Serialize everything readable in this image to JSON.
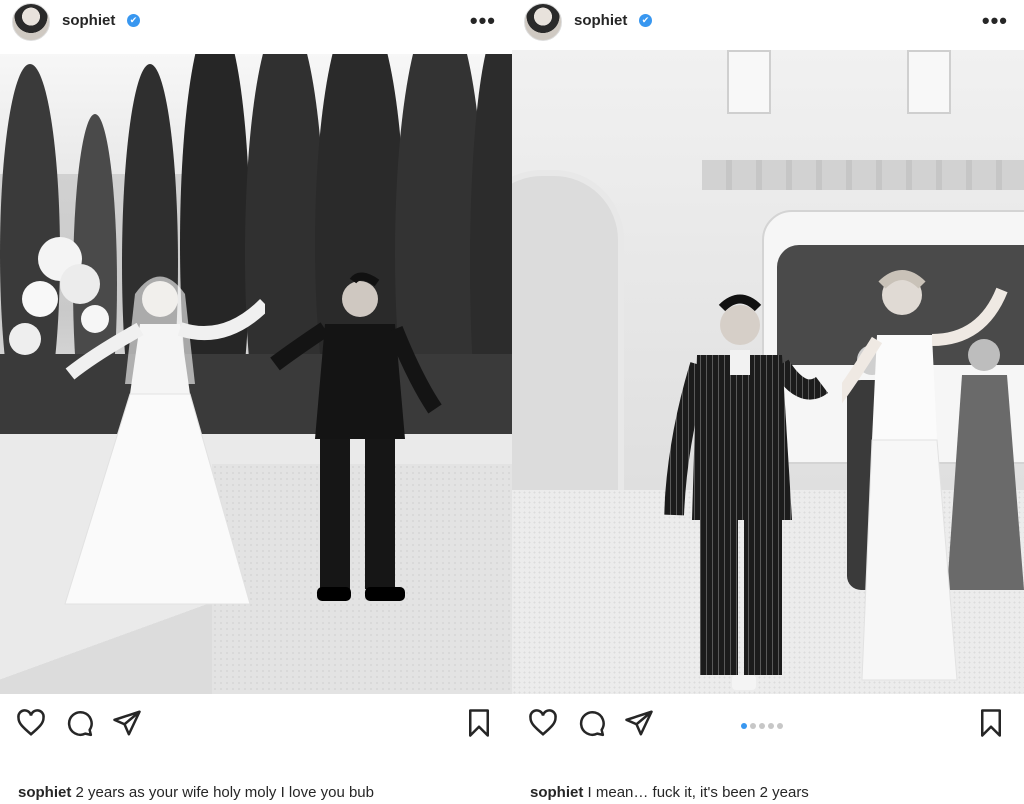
{
  "posts": [
    {
      "username": "sophiet",
      "verified_badge": "✔",
      "more_icon": "•••",
      "caption_text": "2 years as your wife holy moly I love you bub",
      "icons": [
        "heart-icon",
        "comment-icon",
        "share-icon",
        "bookmark-icon",
        "user-tag-icon"
      ]
    },
    {
      "username": "sophiet",
      "verified_badge": "✔",
      "more_icon": "•••",
      "caption_text": "I mean… fuck it, it's been 2 years",
      "carousel": {
        "total": 5,
        "active_index": 1
      },
      "icons": [
        "heart-icon",
        "comment-icon",
        "share-icon",
        "bookmark-icon"
      ]
    }
  ],
  "colors": {
    "verified": "#3897f0",
    "text": "#262626",
    "carousel_active": "#3897f0"
  }
}
